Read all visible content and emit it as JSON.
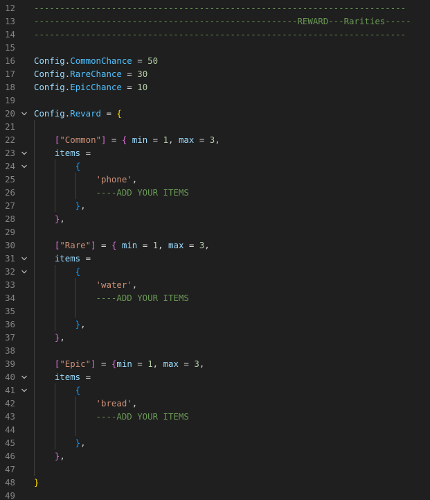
{
  "editor": {
    "colors": {
      "background": "#1f1f1f",
      "line_number": "#858585",
      "comment": "#6a9955",
      "string": "#ce9178",
      "number": "#b5cea8",
      "identifier": "#9cdcfe",
      "property": "#4fc1ff",
      "bracket_level_1": "#ffd700",
      "bracket_level_2": "#da70d6",
      "bracket_level_3": "#179fff"
    },
    "fold_icon": "chevron-down-icon",
    "lines": [
      {
        "n": "12",
        "fold": false,
        "tokens": [
          {
            "t": "------------------------------------------------------------------------",
            "c": "comment"
          }
        ]
      },
      {
        "n": "13",
        "fold": false,
        "tokens": [
          {
            "t": "---------------------------------------------------REWARD---Rarities-----",
            "c": "comment"
          }
        ]
      },
      {
        "n": "14",
        "fold": false,
        "tokens": [
          {
            "t": "------------------------------------------------------------------------",
            "c": "comment"
          }
        ]
      },
      {
        "n": "15",
        "fold": false,
        "tokens": []
      },
      {
        "n": "16",
        "fold": false,
        "tokens": [
          {
            "t": "Config",
            "c": "cfg"
          },
          {
            "t": ".",
            "c": "op"
          },
          {
            "t": "CommonChance",
            "c": "prop"
          },
          {
            "t": " = ",
            "c": "op"
          },
          {
            "t": "50",
            "c": "num"
          }
        ]
      },
      {
        "n": "17",
        "fold": false,
        "tokens": [
          {
            "t": "Config",
            "c": "cfg"
          },
          {
            "t": ".",
            "c": "op"
          },
          {
            "t": "RareChance",
            "c": "prop"
          },
          {
            "t": " = ",
            "c": "op"
          },
          {
            "t": "30",
            "c": "num"
          }
        ]
      },
      {
        "n": "18",
        "fold": false,
        "tokens": [
          {
            "t": "Config",
            "c": "cfg"
          },
          {
            "t": ".",
            "c": "op"
          },
          {
            "t": "EpicChance",
            "c": "prop"
          },
          {
            "t": " = ",
            "c": "op"
          },
          {
            "t": "10",
            "c": "num"
          }
        ]
      },
      {
        "n": "19",
        "fold": false,
        "tokens": []
      },
      {
        "n": "20",
        "fold": true,
        "tokens": [
          {
            "t": "Config",
            "c": "cfg"
          },
          {
            "t": ".",
            "c": "op"
          },
          {
            "t": "Revard",
            "c": "prop"
          },
          {
            "t": " = ",
            "c": "op"
          },
          {
            "t": "{",
            "c": "b1"
          }
        ]
      },
      {
        "n": "21",
        "fold": false,
        "tokens": []
      },
      {
        "n": "22",
        "fold": false,
        "tokens": [
          {
            "t": "    ",
            "c": "op"
          },
          {
            "t": "[",
            "c": "b2"
          },
          {
            "t": "\"Common\"",
            "c": "str"
          },
          {
            "t": "]",
            "c": "b2"
          },
          {
            "t": " = ",
            "c": "op"
          },
          {
            "t": "{",
            "c": "b2"
          },
          {
            "t": " ",
            "c": "op"
          },
          {
            "t": "min",
            "c": "cfg"
          },
          {
            "t": " = ",
            "c": "op"
          },
          {
            "t": "1",
            "c": "num"
          },
          {
            "t": ", ",
            "c": "op"
          },
          {
            "t": "max",
            "c": "cfg"
          },
          {
            "t": " = ",
            "c": "op"
          },
          {
            "t": "3",
            "c": "num"
          },
          {
            "t": ",",
            "c": "op"
          }
        ]
      },
      {
        "n": "23",
        "fold": true,
        "tokens": [
          {
            "t": "    ",
            "c": "op"
          },
          {
            "t": "items",
            "c": "cfg"
          },
          {
            "t": " =",
            "c": "op"
          }
        ]
      },
      {
        "n": "24",
        "fold": true,
        "tokens": [
          {
            "t": "        ",
            "c": "op"
          },
          {
            "t": "{",
            "c": "b3"
          }
        ]
      },
      {
        "n": "25",
        "fold": false,
        "tokens": [
          {
            "t": "            ",
            "c": "op"
          },
          {
            "t": "'phone'",
            "c": "str"
          },
          {
            "t": ",",
            "c": "op"
          }
        ]
      },
      {
        "n": "26",
        "fold": false,
        "tokens": [
          {
            "t": "            ",
            "c": "op"
          },
          {
            "t": "----ADD YOUR ITEMS",
            "c": "comment"
          }
        ]
      },
      {
        "n": "27",
        "fold": false,
        "tokens": [
          {
            "t": "        ",
            "c": "op"
          },
          {
            "t": "}",
            "c": "b3"
          },
          {
            "t": ",",
            "c": "op"
          }
        ]
      },
      {
        "n": "28",
        "fold": false,
        "tokens": [
          {
            "t": "    ",
            "c": "op"
          },
          {
            "t": "}",
            "c": "b2"
          },
          {
            "t": ",",
            "c": "op"
          }
        ]
      },
      {
        "n": "29",
        "fold": false,
        "tokens": []
      },
      {
        "n": "30",
        "fold": false,
        "tokens": [
          {
            "t": "    ",
            "c": "op"
          },
          {
            "t": "[",
            "c": "b2"
          },
          {
            "t": "\"Rare\"",
            "c": "str"
          },
          {
            "t": "]",
            "c": "b2"
          },
          {
            "t": " = ",
            "c": "op"
          },
          {
            "t": "{",
            "c": "b2"
          },
          {
            "t": " ",
            "c": "op"
          },
          {
            "t": "min",
            "c": "cfg"
          },
          {
            "t": " = ",
            "c": "op"
          },
          {
            "t": "1",
            "c": "num"
          },
          {
            "t": ", ",
            "c": "op"
          },
          {
            "t": "max",
            "c": "cfg"
          },
          {
            "t": " = ",
            "c": "op"
          },
          {
            "t": "3",
            "c": "num"
          },
          {
            "t": ",",
            "c": "op"
          }
        ]
      },
      {
        "n": "31",
        "fold": true,
        "tokens": [
          {
            "t": "    ",
            "c": "op"
          },
          {
            "t": "items",
            "c": "cfg"
          },
          {
            "t": " =",
            "c": "op"
          }
        ]
      },
      {
        "n": "32",
        "fold": true,
        "tokens": [
          {
            "t": "        ",
            "c": "op"
          },
          {
            "t": "{",
            "c": "b3"
          }
        ]
      },
      {
        "n": "33",
        "fold": false,
        "tokens": [
          {
            "t": "            ",
            "c": "op"
          },
          {
            "t": "'water'",
            "c": "str"
          },
          {
            "t": ",",
            "c": "op"
          }
        ]
      },
      {
        "n": "34",
        "fold": false,
        "tokens": [
          {
            "t": "            ",
            "c": "op"
          },
          {
            "t": "----ADD YOUR ITEMS",
            "c": "comment"
          }
        ]
      },
      {
        "n": "35",
        "fold": false,
        "tokens": []
      },
      {
        "n": "36",
        "fold": false,
        "tokens": [
          {
            "t": "        ",
            "c": "op"
          },
          {
            "t": "}",
            "c": "b3"
          },
          {
            "t": ",",
            "c": "op"
          }
        ]
      },
      {
        "n": "37",
        "fold": false,
        "tokens": [
          {
            "t": "    ",
            "c": "op"
          },
          {
            "t": "}",
            "c": "b2"
          },
          {
            "t": ",",
            "c": "op"
          }
        ]
      },
      {
        "n": "38",
        "fold": false,
        "tokens": []
      },
      {
        "n": "39",
        "fold": false,
        "tokens": [
          {
            "t": "    ",
            "c": "op"
          },
          {
            "t": "[",
            "c": "b2"
          },
          {
            "t": "\"Epic\"",
            "c": "str"
          },
          {
            "t": "]",
            "c": "b2"
          },
          {
            "t": " = ",
            "c": "op"
          },
          {
            "t": "{",
            "c": "b2"
          },
          {
            "t": "min",
            "c": "cfg"
          },
          {
            "t": " = ",
            "c": "op"
          },
          {
            "t": "1",
            "c": "num"
          },
          {
            "t": ", ",
            "c": "op"
          },
          {
            "t": "max",
            "c": "cfg"
          },
          {
            "t": " = ",
            "c": "op"
          },
          {
            "t": "3",
            "c": "num"
          },
          {
            "t": ",",
            "c": "op"
          }
        ]
      },
      {
        "n": "40",
        "fold": true,
        "tokens": [
          {
            "t": "    ",
            "c": "op"
          },
          {
            "t": "items",
            "c": "cfg"
          },
          {
            "t": " =",
            "c": "op"
          }
        ]
      },
      {
        "n": "41",
        "fold": true,
        "tokens": [
          {
            "t": "        ",
            "c": "op"
          },
          {
            "t": "{",
            "c": "b3"
          }
        ]
      },
      {
        "n": "42",
        "fold": false,
        "tokens": [
          {
            "t": "            ",
            "c": "op"
          },
          {
            "t": "'bread'",
            "c": "str"
          },
          {
            "t": ",",
            "c": "op"
          }
        ]
      },
      {
        "n": "43",
        "fold": false,
        "tokens": [
          {
            "t": "            ",
            "c": "op"
          },
          {
            "t": "----ADD YOUR ITEMS",
            "c": "comment"
          }
        ]
      },
      {
        "n": "44",
        "fold": false,
        "tokens": []
      },
      {
        "n": "45",
        "fold": false,
        "tokens": [
          {
            "t": "        ",
            "c": "op"
          },
          {
            "t": "}",
            "c": "b3"
          },
          {
            "t": ",",
            "c": "op"
          }
        ]
      },
      {
        "n": "46",
        "fold": false,
        "tokens": [
          {
            "t": "    ",
            "c": "op"
          },
          {
            "t": "}",
            "c": "b2"
          },
          {
            "t": ",",
            "c": "op"
          }
        ]
      },
      {
        "n": "47",
        "fold": false,
        "tokens": []
      },
      {
        "n": "48",
        "fold": false,
        "tokens": [
          {
            "t": "}",
            "c": "b1"
          }
        ]
      },
      {
        "n": "49",
        "fold": false,
        "tokens": []
      }
    ]
  }
}
